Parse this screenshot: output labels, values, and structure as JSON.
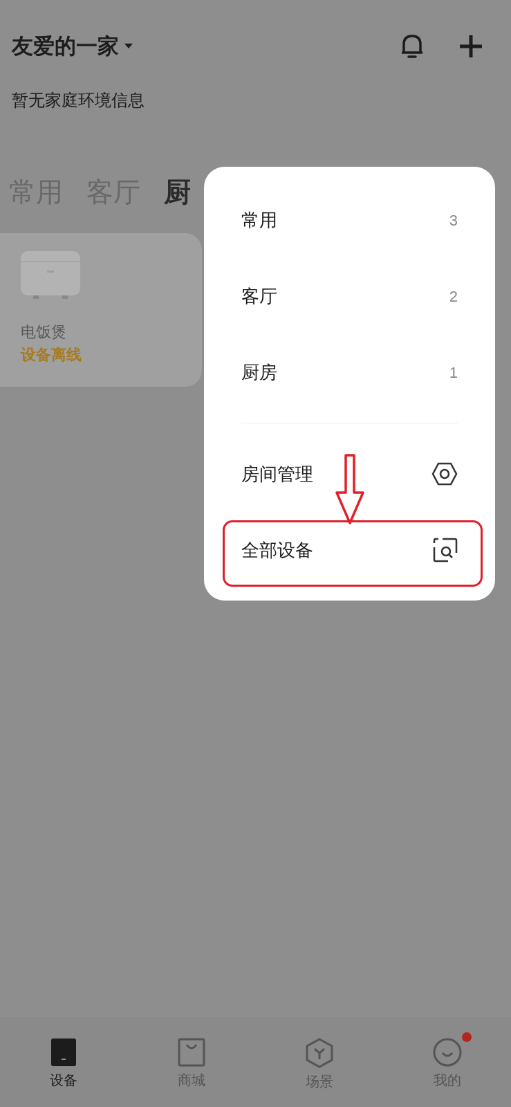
{
  "header": {
    "home_name": "友爱的一家",
    "environment": "暂无家庭环境信息"
  },
  "room_tabs": [
    {
      "label": "常用",
      "selected": false
    },
    {
      "label": "客厅",
      "selected": false
    },
    {
      "label": "厨",
      "selected": true
    }
  ],
  "device_card": {
    "name": "电饭煲",
    "status": "设备离线"
  },
  "room_menu": [
    {
      "kind": "count",
      "label": "常用",
      "count": "3"
    },
    {
      "kind": "count",
      "label": "客厅",
      "count": "2"
    },
    {
      "kind": "count",
      "label": "厨房",
      "count": "1"
    },
    {
      "kind": "divider"
    },
    {
      "kind": "manage",
      "label": "房间管理"
    },
    {
      "kind": "all",
      "label": "全部设备",
      "highlighted": true
    }
  ],
  "bottom_nav": [
    {
      "label": "设备",
      "kind": "device",
      "selected": true,
      "badge": false
    },
    {
      "label": "商城",
      "kind": "bag",
      "selected": false,
      "badge": false
    },
    {
      "label": "场景",
      "kind": "hex",
      "selected": false,
      "badge": false
    },
    {
      "label": "我的",
      "kind": "smile",
      "selected": false,
      "badge": true
    }
  ]
}
